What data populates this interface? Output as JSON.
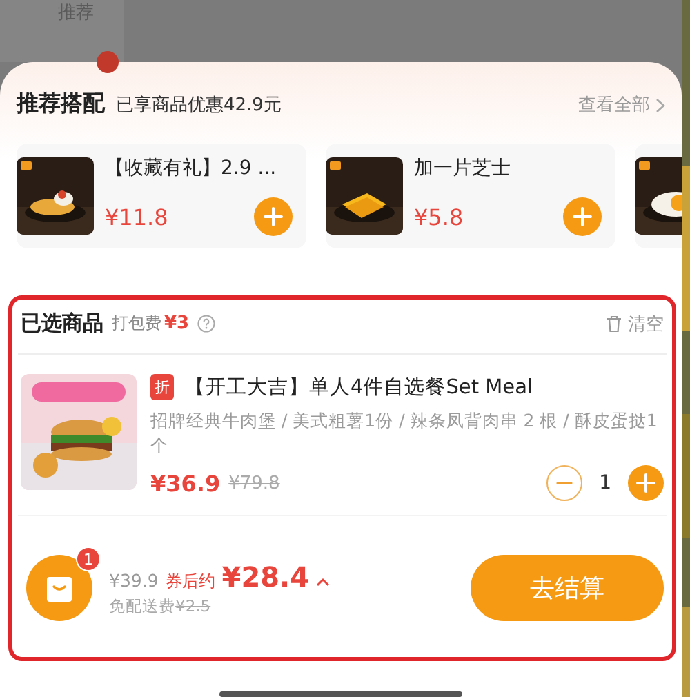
{
  "background": {
    "sidebar_label": "推荐"
  },
  "recommend": {
    "title": "推荐搭配",
    "saving": "已享商品优惠42.9元",
    "view_all": "查看全部",
    "items": [
      {
        "name": "【收藏有礼】2.9 ...",
        "price": "¥11.8"
      },
      {
        "name": "加一片芝士",
        "price": "¥5.8"
      }
    ]
  },
  "selected": {
    "title": "已选商品",
    "packing_label": "打包费",
    "packing_fee": "¥3",
    "clear": "清空",
    "items": [
      {
        "tag": "折",
        "name": "【开工大吉】单人4件自选餐Set Meal",
        "desc": "招牌经典牛肉堡 / 美式粗薯1份 / 辣条凤背肉串 2 根 / 酥皮蛋挞1个",
        "price": "¥36.9",
        "original_price": "¥79.8",
        "quantity": "1"
      }
    ]
  },
  "checkout": {
    "cart_count": "1",
    "original_total": "¥39.9",
    "coupon_label": "券后约",
    "total": "¥28.4",
    "delivery": "免配送费",
    "delivery_original": "¥2.5",
    "button": "去结算"
  }
}
